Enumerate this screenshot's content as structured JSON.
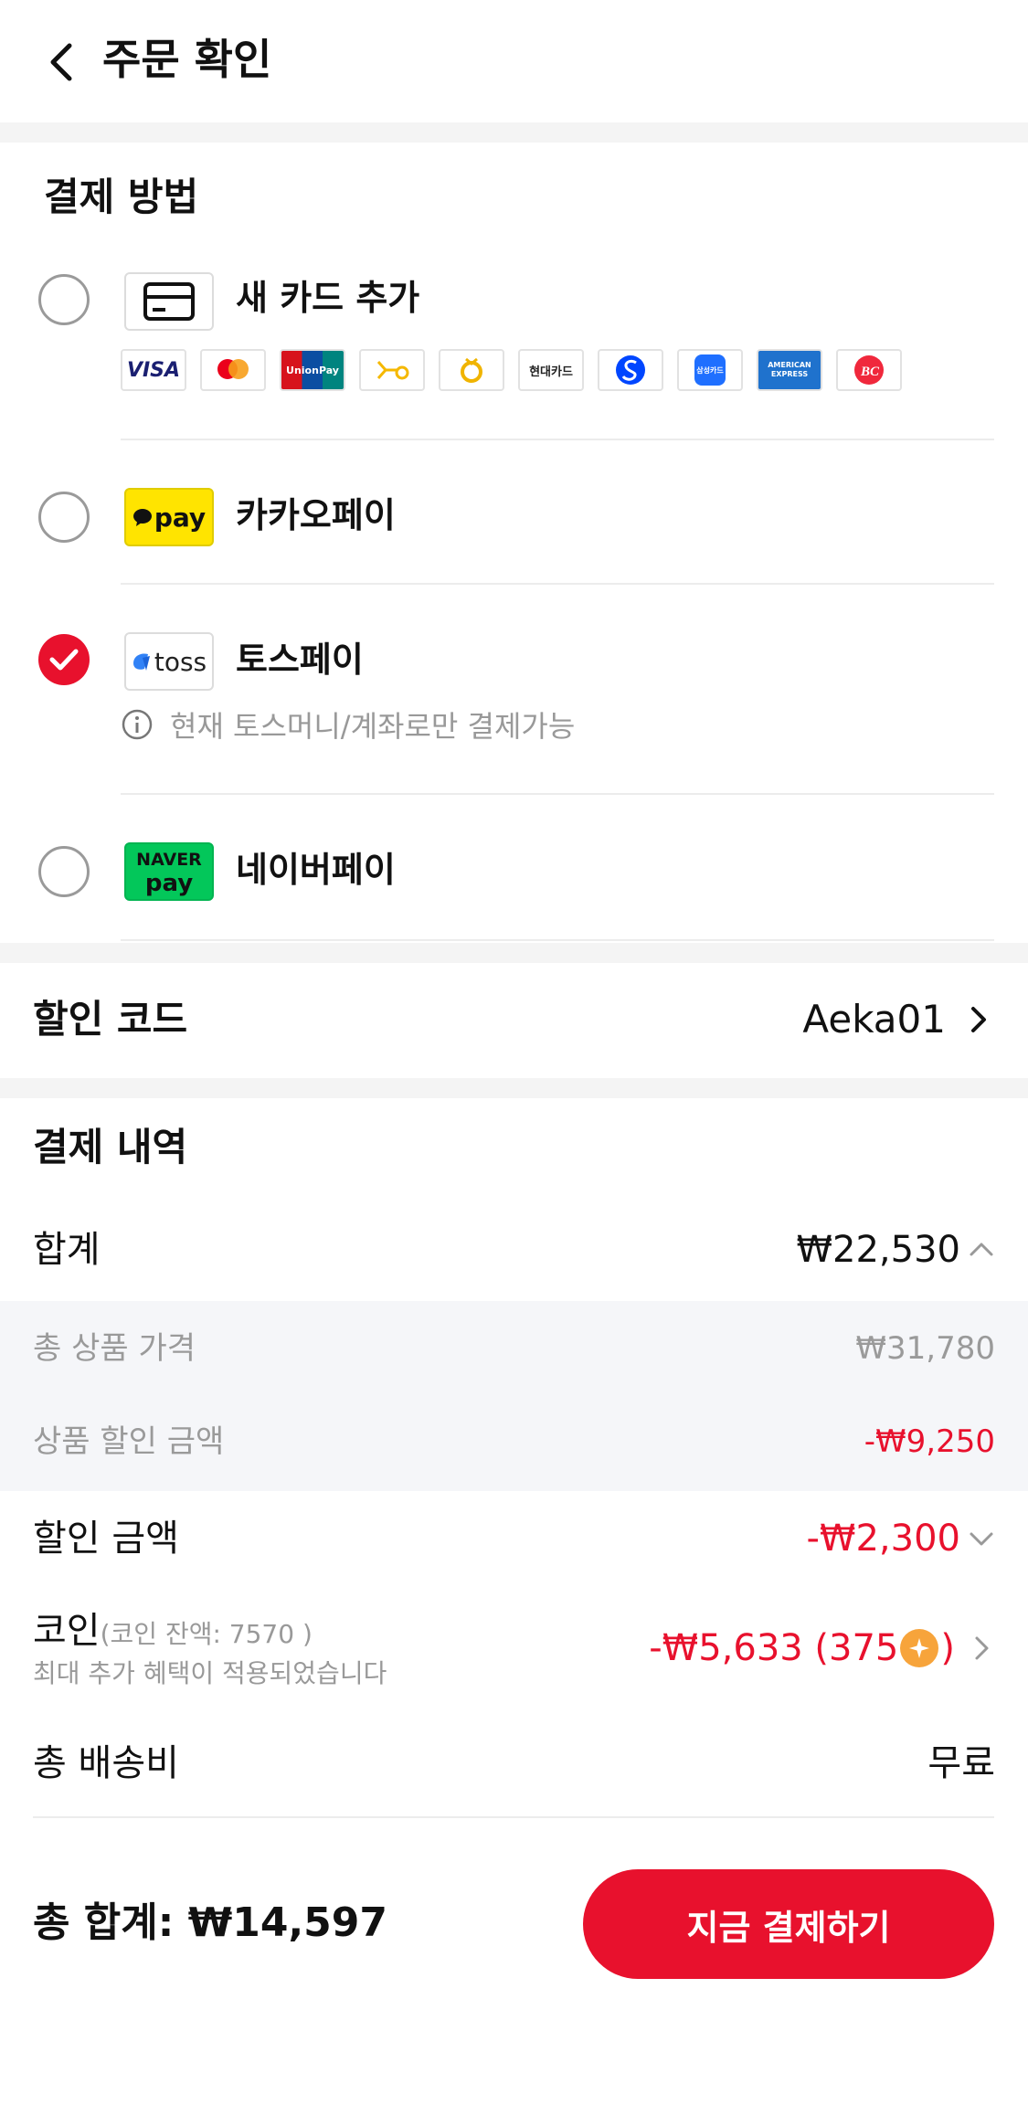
{
  "header": {
    "title": "주문 확인"
  },
  "payment_method": {
    "title": "결제 방법",
    "methods": [
      {
        "label": "새 카드 추가",
        "selected": false
      },
      {
        "label": "카카오페이",
        "selected": false,
        "logo_text": "pay"
      },
      {
        "label": "토스페이",
        "selected": true,
        "logo_text": "toss",
        "note": "현재 토스머니/계좌로만 결제가능"
      },
      {
        "label": "네이버페이",
        "selected": false,
        "logo_text_top": "NAVER",
        "logo_text_bottom": "pay"
      }
    ],
    "card_brands": [
      "VISA",
      "mastercard",
      "UnionPay",
      "KB",
      "NH",
      "현대카드",
      "신한",
      "삼성카드",
      "AMERICAN EXPRESS",
      "BC"
    ],
    "card_brand_labels": {
      "visa": "VISA",
      "unionpay": "UnionPay",
      "hyundai": "현대카드",
      "samsung": "삼성카드",
      "amex": "AMERICAN EXPRESS"
    }
  },
  "discount_code": {
    "label": "할인 코드",
    "value": "Aeka01"
  },
  "payment_details": {
    "title": "결제 내역",
    "subtotal_label": "합계",
    "subtotal_value": "₩22,530",
    "product_total_label": "총 상품 가격",
    "product_total_value": "₩31,780",
    "product_discount_label": "상품 할인 금액",
    "product_discount_value": "-₩9,250",
    "discount_label": "할인 금액",
    "discount_value": "-₩2,300",
    "coin_label": "코인",
    "coin_balance": "(코인 잔액: 7570 )",
    "coin_note": "최대 추가 혜택이 적용되었습니다",
    "coin_value_prefix": "-₩5,633 (375",
    "coin_value_suffix": ")",
    "shipping_label": "총 배송비",
    "shipping_value": "무료"
  },
  "footer": {
    "total_label": "총 합계:",
    "total_value": "₩14,597",
    "pay_button": "지금 결제하기"
  },
  "colors": {
    "accent": "#e8112d",
    "kakao_yellow": "#ffe400",
    "naver_green": "#03c75a",
    "coin": "#f7a43b"
  }
}
